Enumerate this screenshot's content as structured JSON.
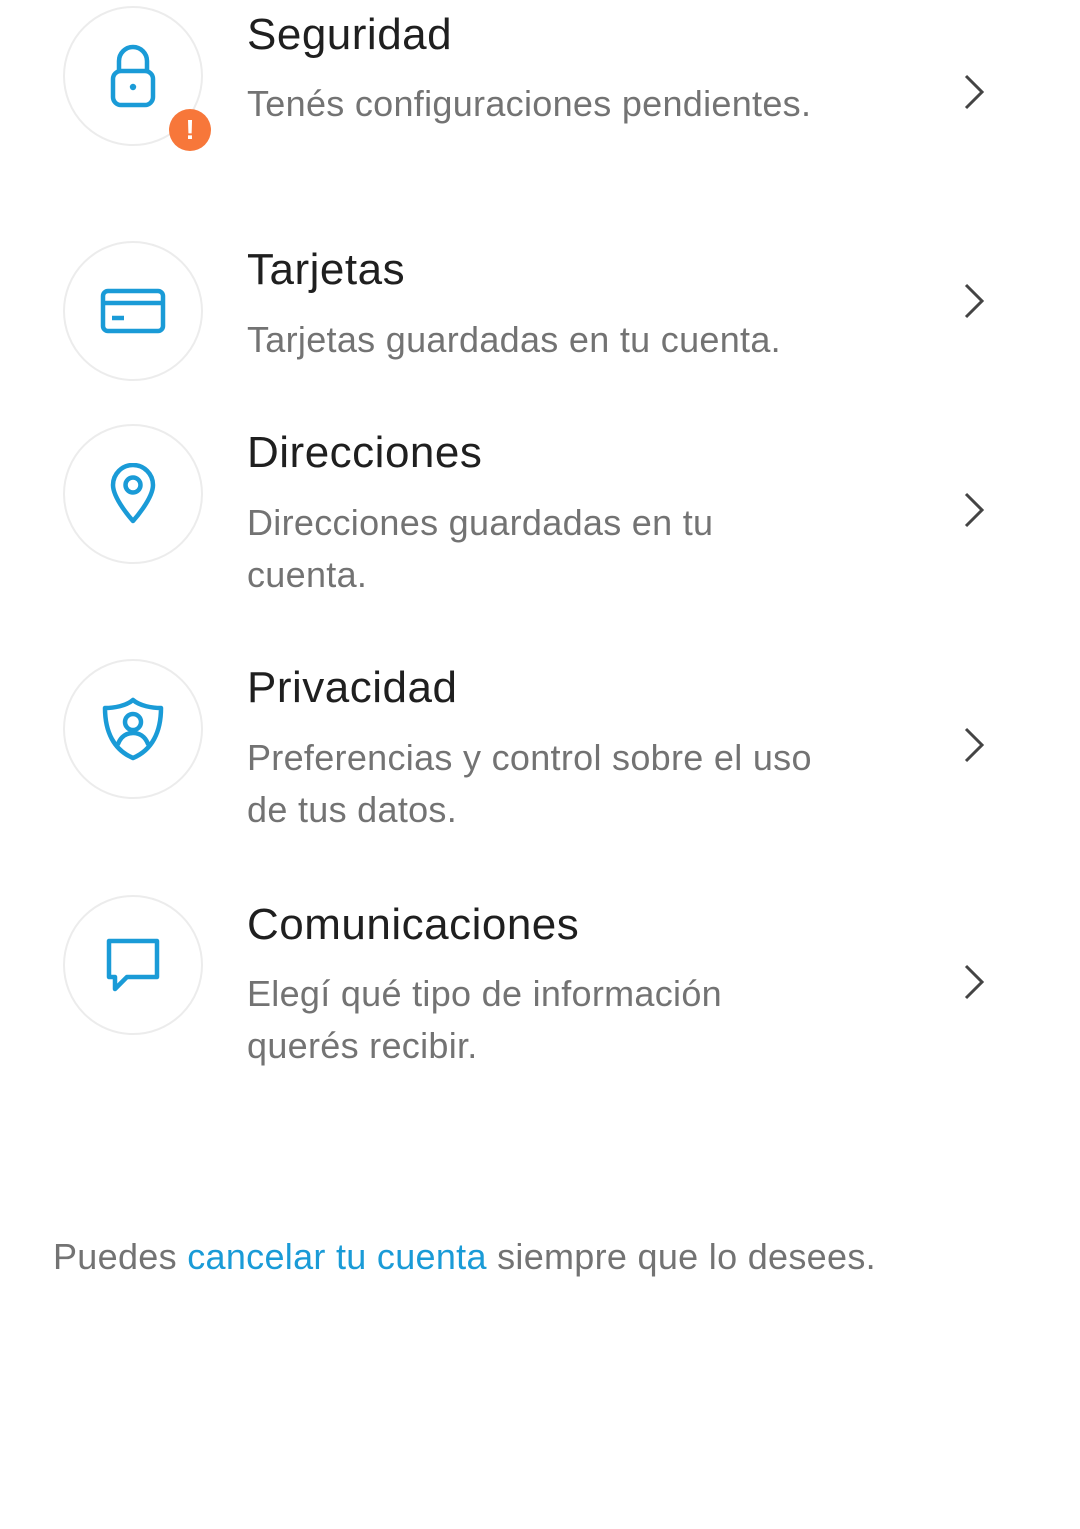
{
  "colors": {
    "accent": "#1a9bd7",
    "warning": "#f7773a",
    "title": "#1f1f1f",
    "secondary": "#737373",
    "divider": "#ececec"
  },
  "items": [
    {
      "title": "Seguridad",
      "description": "Tenés configuraciones pendientes.",
      "icon": "lock-icon",
      "badge": "!"
    },
    {
      "title": "Tarjetas",
      "description": "Tarjetas guardadas en tu cuenta.",
      "icon": "credit-card-icon"
    },
    {
      "title": "Direcciones",
      "description": "Direcciones guardadas en tu cuenta.",
      "icon": "location-pin-icon"
    },
    {
      "title": "Privacidad",
      "description": "Preferencias y control sobre el uso de tus datos.",
      "icon": "shield-user-icon"
    },
    {
      "title": "Comunicaciones",
      "description": "Elegí qué tipo de información querés recibir.",
      "icon": "chat-bubble-icon"
    }
  ],
  "footer": {
    "before_link": "Puedes ",
    "link": "cancelar tu cuenta",
    "after_link": " siempre que lo desees."
  }
}
